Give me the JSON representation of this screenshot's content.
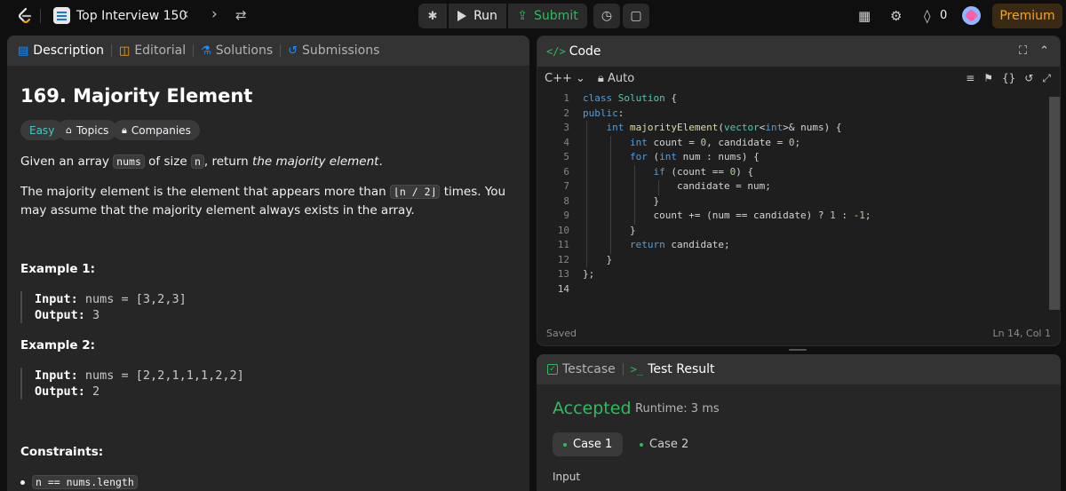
{
  "nav": {
    "title": "Top Interview 150",
    "prev_icon": "chevron-left-icon",
    "next_icon": "chevron-right-icon",
    "run_label": "Run",
    "submit_label": "Submit",
    "streak_count": "0",
    "premium_label": "Premium",
    "colors": {
      "accent": "#ffa116",
      "green": "#2cbb5d"
    }
  },
  "left": {
    "tabs": [
      {
        "label": "Description",
        "icon": "document-icon"
      },
      {
        "label": "Editorial",
        "icon": "book-icon"
      },
      {
        "label": "Solutions",
        "icon": "flask-icon"
      },
      {
        "label": "Submissions",
        "icon": "history-icon"
      }
    ],
    "title": "169. Majority Element",
    "chips": {
      "difficulty": "Easy",
      "topics": "Topics",
      "companies": "Companies"
    },
    "desc1": {
      "a": "Given an array ",
      "code1": "nums",
      "b": " of size ",
      "code2": "n",
      "c": ", return ",
      "em": "the majority element",
      "d": "."
    },
    "desc2": {
      "a": "The majority element is the element that appears more than ",
      "code": "⌊n / 2⌋",
      "b": " times. You may assume that the majority element always exists in the array."
    },
    "example1": {
      "head": "Example 1:",
      "input_label": "Input:",
      "input_value": " nums = [3,2,3]",
      "output_label": "Output:",
      "output_value": " 3"
    },
    "example2": {
      "head": "Example 2:",
      "input_label": "Input:",
      "input_value": " nums = [2,2,1,1,1,2,2]",
      "output_label": "Output:",
      "output_value": " 2"
    },
    "constraints_head": "Constraints:",
    "constraint1": "n == nums.length"
  },
  "code": {
    "title": "Code",
    "language": "C++",
    "mode": "Auto",
    "line_numbers": [
      "1",
      "2",
      "3",
      "4",
      "5",
      "6",
      "7",
      "8",
      "9",
      "10",
      "11",
      "12",
      "13",
      "14"
    ],
    "saved": "Saved",
    "cursor": "Ln 14, Col 1"
  },
  "result": {
    "tab_testcase": "Testcase",
    "tab_result": "Test Result",
    "status": "Accepted",
    "runtime": "Runtime: 3 ms",
    "case1": "Case 1",
    "case2": "Case 2",
    "input_label": "Input"
  }
}
